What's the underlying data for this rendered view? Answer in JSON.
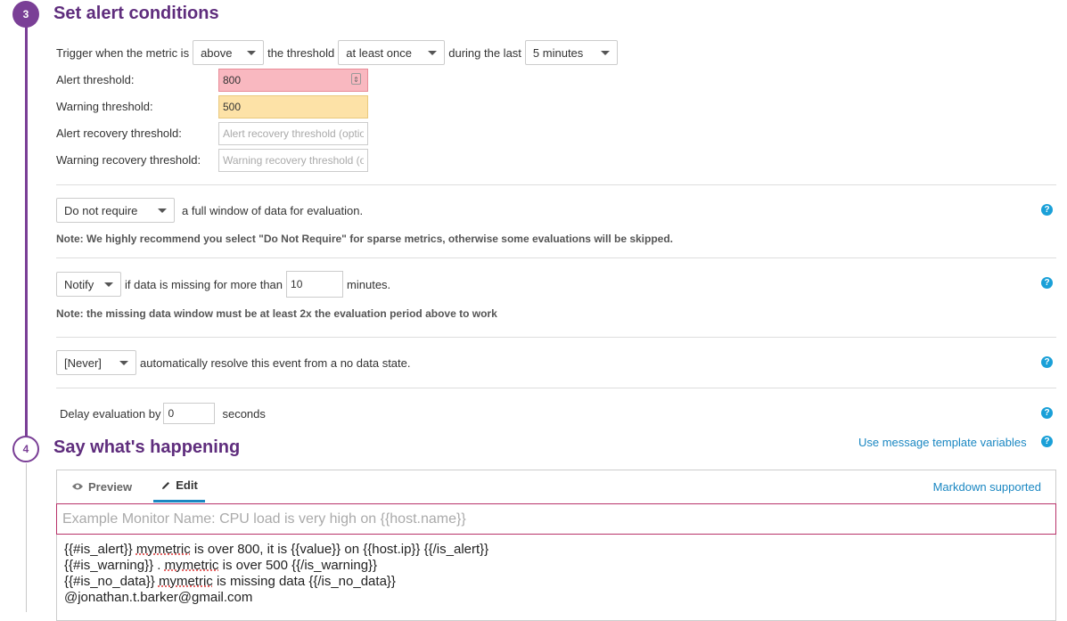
{
  "step3": {
    "number": "3",
    "title": "Set alert conditions",
    "trigger": {
      "prefix": "Trigger when the metric is",
      "comparator": "above",
      "middle": "the threshold",
      "frequency": "at least once",
      "suffix": "during the last",
      "window": "5 minutes"
    },
    "thresholds": {
      "alert_label": "Alert threshold:",
      "alert_value": "800",
      "warning_label": "Warning threshold:",
      "warning_value": "500",
      "alert_recovery_label": "Alert recovery threshold:",
      "alert_recovery_placeholder": "Alert recovery threshold (optional)",
      "warning_recovery_label": "Warning recovery threshold:",
      "warning_recovery_placeholder": "Warning recovery threshold (optional)"
    },
    "full_window": {
      "select": "Do not require",
      "text": "a full window of data for evaluation.",
      "note": "Note: We highly recommend you select \"Do Not Require\" for sparse metrics, otherwise some evaluations will be skipped."
    },
    "missing_data": {
      "select": "Notify",
      "text": "if data is missing for more than",
      "minutes_value": "10",
      "unit": "minutes.",
      "note": "Note: the missing data window must be at least 2x the evaluation period above to work"
    },
    "resolve": {
      "select": "[Never]",
      "text": "automatically resolve this event from a no data state."
    },
    "delay": {
      "label": "Delay evaluation by",
      "value": "0",
      "unit": "seconds"
    },
    "help_glyph": "?"
  },
  "step4": {
    "number": "4",
    "title": "Say what's happening",
    "template_link": "Use message template variables",
    "tabs": {
      "preview": "Preview",
      "edit": "Edit"
    },
    "markdown_link": "Markdown supported",
    "title_placeholder": "Example Monitor Name: CPU load is very high on {{host.name}}",
    "message": {
      "l1a": "{{#is_alert}}",
      "l1b": "mymetric",
      "l1c": " is over 800, it is {{value}} on {{host.ip}} {{/is_alert}}",
      "l2a": "{{#is_warning}}",
      "l2b": " . ",
      "l2c": "mymetric",
      "l2d": " is over 500 {{/is_warning}}",
      "l3a": "{{#is_no_data}}",
      "l3b": "mymetric",
      "l3c": " is missing data {{/is_no_data}}",
      "l4": "@jonathan.t.barker@gmail.com"
    }
  },
  "colors": {
    "accent": "#7a3f96",
    "title": "#5f2d7d",
    "link": "#1a87c2",
    "alert_bg": "#f9b8c0",
    "warning_bg": "#fde2a7"
  }
}
